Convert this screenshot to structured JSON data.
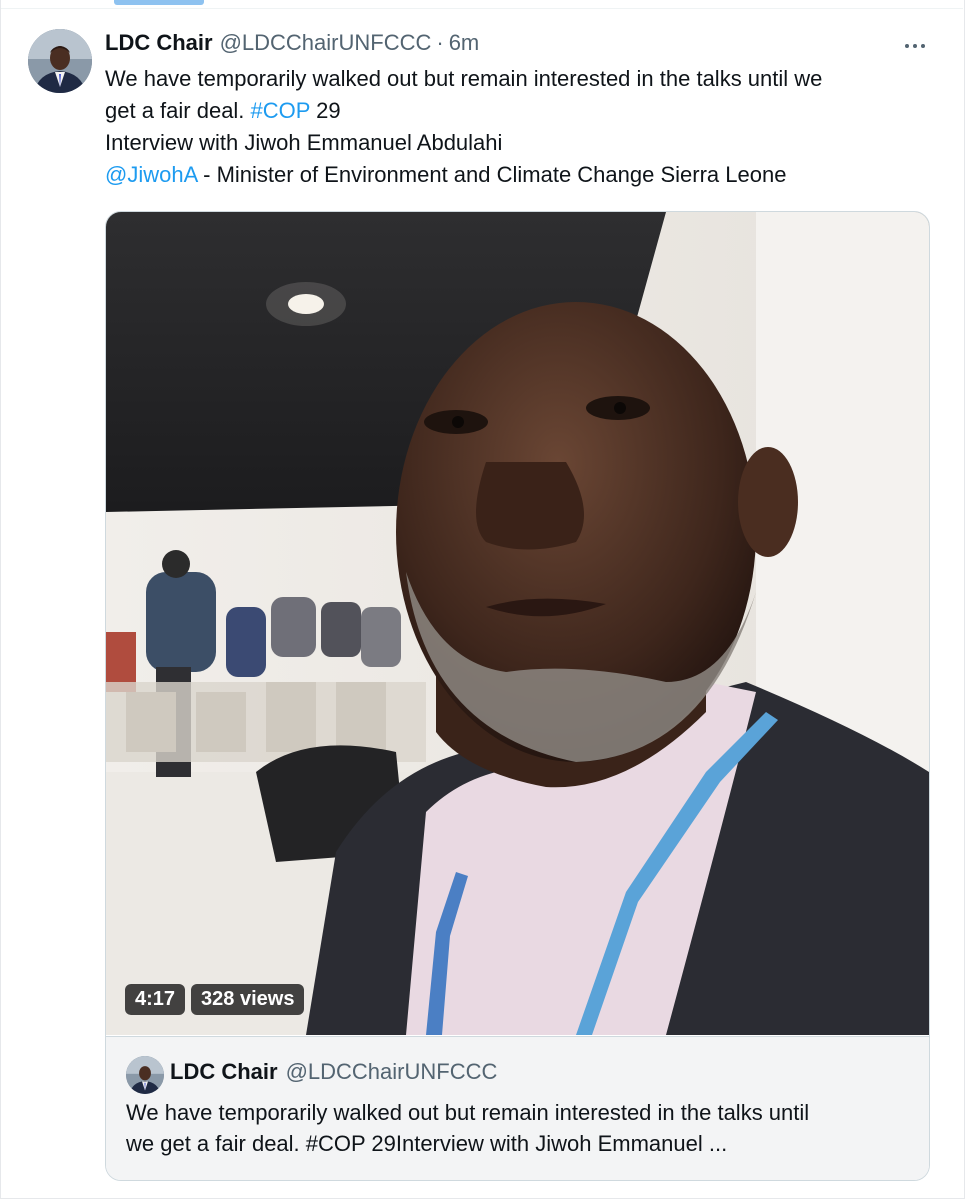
{
  "tweet": {
    "author": {
      "display_name": "LDC Chair",
      "handle": "@LDCChairUNFCCC",
      "separator": "·",
      "time": "6m"
    },
    "text": {
      "line1": "We have temporarily walked out but remain interested in the talks until we",
      "line2_before": "get a fair deal. ",
      "hashtag": "#COP",
      "line2_after": " 29",
      "line3": "Interview with Jiwoh Emmanuel Abdulahi",
      "mention": "@JiwohA",
      "line4_after": "  - Minister of Environment and Climate Change Sierra Leone"
    },
    "video": {
      "duration": "4:17",
      "views": "328 views"
    },
    "quoted": {
      "display_name": "LDC Chair",
      "handle": "@LDCChairUNFCCC",
      "line1": "We have temporarily walked out but remain interested in the talks until",
      "line2": "we get a fair deal. #COP 29Interview with Jiwoh Emmanuel ..."
    }
  },
  "colors": {
    "link": "#1d9bf0",
    "text": "#0f1419",
    "muted": "#536471",
    "quote_bg": "#f3f4f5",
    "border": "#cfd9de"
  },
  "icons": {
    "more": "more-horizontal-icon"
  }
}
